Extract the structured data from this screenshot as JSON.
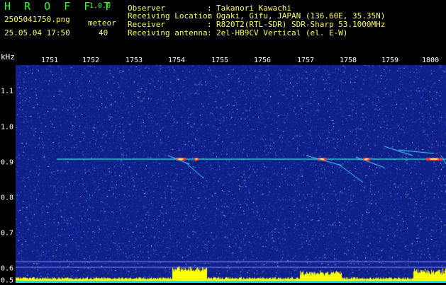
{
  "header": {
    "app_title": "H R O F F T",
    "app_version": "1.0.0",
    "file_name": "2505041750.png",
    "date_time": "25.05.04 17:50",
    "meteor_label": "meteor",
    "meteor_count": "40"
  },
  "station_info": [
    {
      "label": "Observer",
      "value": "Takanori Kawachi"
    },
    {
      "label": "Receiving Location",
      "value": "Ogaki, Gifu, JAPAN (136.60E, 35.35N)"
    },
    {
      "label": "Receiver",
      "value": "R820T2(RTL-SDR) SDR-Sharp 53.1000MHz"
    },
    {
      "label": "Receiving antenna",
      "value": "2el-HB9CV Vertical (el. E-W)"
    }
  ],
  "colon": ":",
  "axis": {
    "unit": "kHz",
    "time_ticks": [
      "1751",
      "1752",
      "1753",
      "1754",
      "1755",
      "1756",
      "1757",
      "1758",
      "1759",
      "1800"
    ],
    "freq_ticks": [
      "1.1",
      "1.0",
      "0.9",
      "0.8",
      "0.7",
      "0.6",
      "0.5"
    ]
  },
  "colors": {
    "background": "#000000",
    "spectrogram_bg": "#10208a",
    "meteor_trace": "#ff3333",
    "trace_line": "#22cccc",
    "power_bar": "#ffff00",
    "baseline": "#00e5ff",
    "text_white": "#ffffff",
    "text_green": "#33ff33",
    "text_yellow": "#ffff66"
  }
}
